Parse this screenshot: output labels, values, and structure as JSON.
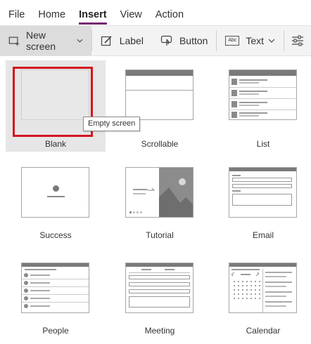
{
  "menu": {
    "items": [
      {
        "label": "File",
        "active": false
      },
      {
        "label": "Home",
        "active": false
      },
      {
        "label": "Insert",
        "active": true
      },
      {
        "label": "View",
        "active": false
      },
      {
        "label": "Action",
        "active": false
      }
    ],
    "accent_color": "#742774"
  },
  "toolbar": {
    "new_screen_label": "New screen",
    "label_label": "Label",
    "button_label": "Button",
    "text_label": "Text",
    "text_icon_glyph": "Abc"
  },
  "gallery": {
    "tiles": [
      {
        "label": "Blank",
        "icon": "blank-screen-thumbnail",
        "selected": true
      },
      {
        "label": "Scrollable",
        "icon": "scrollable-screen-thumbnail"
      },
      {
        "label": "List",
        "icon": "list-screen-thumbnail"
      },
      {
        "label": "Success",
        "icon": "success-screen-thumbnail"
      },
      {
        "label": "Tutorial",
        "icon": "tutorial-screen-thumbnail"
      },
      {
        "label": "Email",
        "icon": "email-screen-thumbnail"
      },
      {
        "label": "People",
        "icon": "people-screen-thumbnail"
      },
      {
        "label": "Meeting",
        "icon": "meeting-screen-thumbnail"
      },
      {
        "label": "Calendar",
        "icon": "calendar-screen-thumbnail"
      }
    ],
    "tooltip": "Empty screen",
    "highlight_color": "#d4151c"
  }
}
